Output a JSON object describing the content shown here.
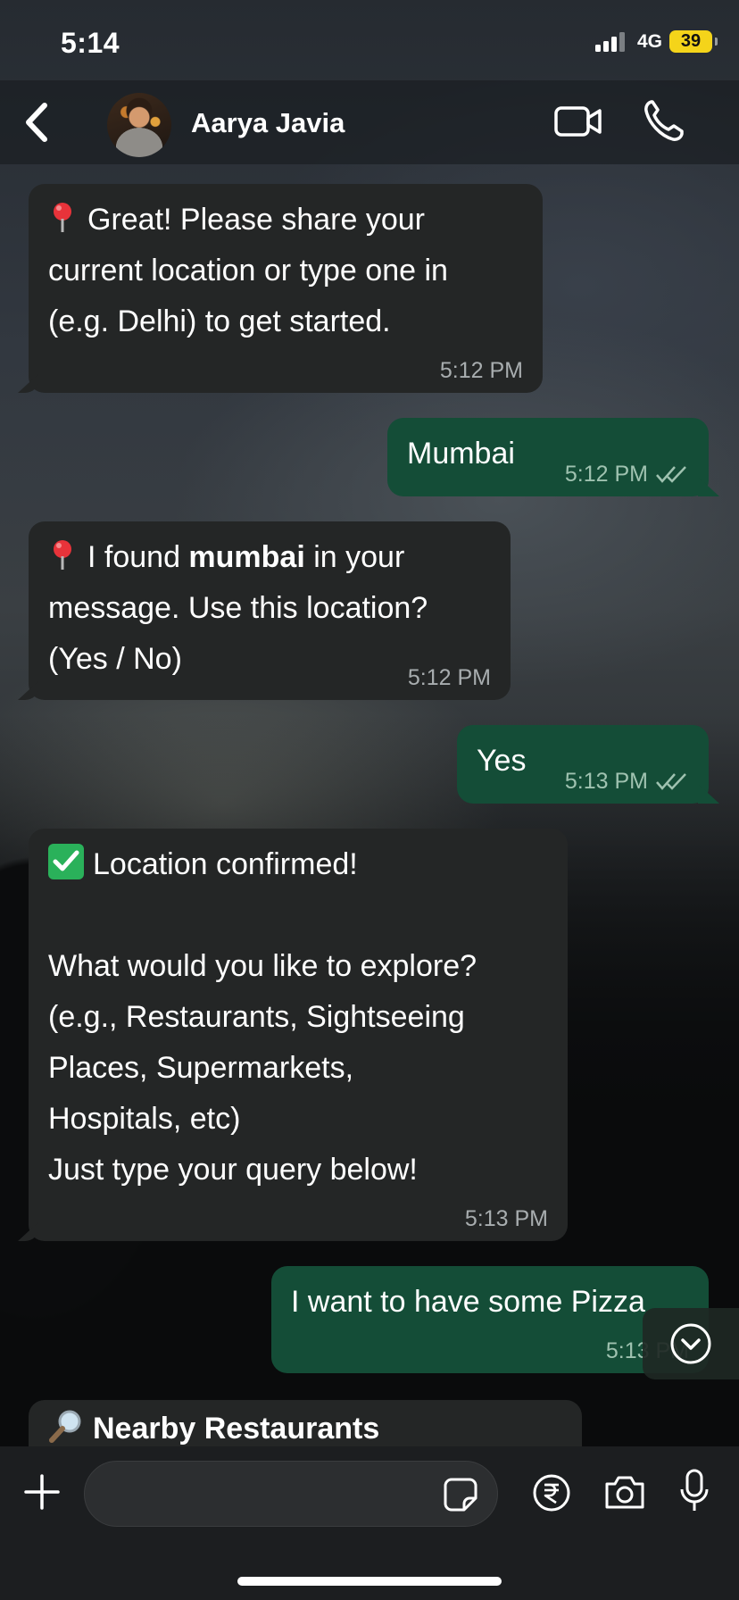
{
  "status_bar": {
    "time": "5:14",
    "network": "4G",
    "battery": "39"
  },
  "header": {
    "back_icon": "chevron-left-icon",
    "contact_name": "Aarya Javia",
    "video_icon": "video-camera-icon",
    "call_icon": "phone-icon"
  },
  "messages": [
    {
      "direction": "incoming",
      "icon": "round-pushpin-emoji",
      "text": "Great! Please share your\ncurrent location or type one in\n(e.g. Delhi) to get started.",
      "time": "5:12 PM"
    },
    {
      "direction": "outgoing",
      "text": "Mumbai",
      "time": "5:12 PM",
      "status": "read"
    },
    {
      "direction": "incoming",
      "icon": "round-pushpin-emoji",
      "text_before": "I found ",
      "text_bold": "mumbai",
      "text_after": " in your\nmessage. Use this location?\n(Yes / No)",
      "time": "5:12 PM"
    },
    {
      "direction": "outgoing",
      "text": "Yes",
      "time": "5:13 PM",
      "status": "read"
    },
    {
      "direction": "incoming",
      "icon": "check-mark-button-emoji",
      "text": "Location confirmed!\n\nWhat would you like to explore?\n(e.g., Restaurants, Sightseeing\nPlaces, Supermarkets,\nHospitals, etc)\nJust type your query below!",
      "time": "5:13 PM"
    },
    {
      "direction": "outgoing",
      "text": "I want to have some Pizza",
      "time": "5:13 PM"
    },
    {
      "direction": "incoming",
      "icon": "magnifying-glass-emoji",
      "text": "Nearby Restaurants"
    }
  ],
  "scroll_down_icon": "chevron-down-circle-icon",
  "input_bar": {
    "plus_icon": "plus-icon",
    "sticker_icon": "sticker-icon",
    "payment_icon": "rupee-icon",
    "camera_icon": "camera-icon",
    "mic_icon": "microphone-icon"
  },
  "colors": {
    "incoming_bubble": "#242626",
    "outgoing_bubble": "#144d37",
    "battery": "#f4d41a",
    "check_emoji": "#2ab15a"
  }
}
